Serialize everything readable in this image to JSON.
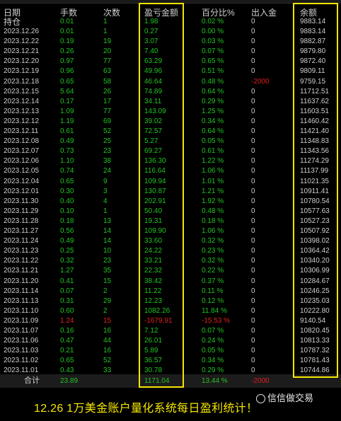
{
  "table": {
    "columns": {
      "date": "日期",
      "qty": "手数",
      "count": "次数",
      "pl": "盈亏金额",
      "pct": "百分比%",
      "flow": "出入金",
      "balance": "余额"
    },
    "holding": {
      "label": "持仓",
      "qty": "0.01",
      "count": "1",
      "pl": "1.98",
      "pct": "0.02 %",
      "flow": "0",
      "balance": "9883.14"
    },
    "rows": [
      {
        "date": "2023.12.26",
        "qty": "0.01",
        "count": "1",
        "pl": "0.27",
        "pct": "0.00 %",
        "flow": "0",
        "balance": "9883.14"
      },
      {
        "date": "2023.12.22",
        "qty": "0.19",
        "count": "19",
        "pl": "3.07",
        "pct": "0.03 %",
        "flow": "0",
        "balance": "9882.87"
      },
      {
        "date": "2023.12.21",
        "qty": "0.26",
        "count": "20",
        "pl": "7.40",
        "pct": "0.07 %",
        "flow": "0",
        "balance": "9879.80"
      },
      {
        "date": "2023.12.20",
        "qty": "0.97",
        "count": "77",
        "pl": "63.29",
        "pct": "0.65 %",
        "flow": "0",
        "balance": "9872.40"
      },
      {
        "date": "2023.12.19",
        "qty": "0.96",
        "count": "63",
        "pl": "49.96",
        "pct": "0.51 %",
        "flow": "0",
        "balance": "9809.11"
      },
      {
        "date": "2023.12.18",
        "qty": "0.65",
        "count": "58",
        "pl": "46.64",
        "pct": "0.48 %",
        "flow": "-2000",
        "balance": "9759.15",
        "flow_neg": true
      },
      {
        "date": "2023.12.15",
        "qty": "5.64",
        "count": "26",
        "pl": "74.89",
        "pct": "0.64 %",
        "flow": "0",
        "balance": "11712.51"
      },
      {
        "date": "2023.12.14",
        "qty": "0.17",
        "count": "17",
        "pl": "34.11",
        "pct": "0.29 %",
        "flow": "0",
        "balance": "11637.62"
      },
      {
        "date": "2023.12.13",
        "qty": "1.09",
        "count": "77",
        "pl": "143.09",
        "pct": "1.25 %",
        "flow": "0",
        "balance": "11603.51"
      },
      {
        "date": "2023.12.12",
        "qty": "1.19",
        "count": "69",
        "pl": "39.02",
        "pct": "0.34 %",
        "flow": "0",
        "balance": "11460.42"
      },
      {
        "date": "2023.12.11",
        "qty": "0.61",
        "count": "52",
        "pl": "72.57",
        "pct": "0.64 %",
        "flow": "0",
        "balance": "11421.40"
      },
      {
        "date": "2023.12.08",
        "qty": "0.49",
        "count": "25",
        "pl": "5.27",
        "pct": "0.05 %",
        "flow": "0",
        "balance": "11348.83"
      },
      {
        "date": "2023.12.07",
        "qty": "0.73",
        "count": "23",
        "pl": "69.27",
        "pct": "0.61 %",
        "flow": "0",
        "balance": "11343.56"
      },
      {
        "date": "2023.12.06",
        "qty": "1.10",
        "count": "38",
        "pl": "136.30",
        "pct": "1.22 %",
        "flow": "0",
        "balance": "11274.29"
      },
      {
        "date": "2023.12.05",
        "qty": "0.74",
        "count": "24",
        "pl": "116.64",
        "pct": "1.06 %",
        "flow": "0",
        "balance": "11137.99"
      },
      {
        "date": "2023.12.04",
        "qty": "0.65",
        "count": "9",
        "pl": "109.94",
        "pct": "1.01 %",
        "flow": "0",
        "balance": "11021.35"
      },
      {
        "date": "2023.12.01",
        "qty": "0.30",
        "count": "3",
        "pl": "130.87",
        "pct": "1.21 %",
        "flow": "0",
        "balance": "10911.41"
      },
      {
        "date": "2023.11.30",
        "qty": "0.40",
        "count": "4",
        "pl": "202.91",
        "pct": "1.92 %",
        "flow": "0",
        "balance": "10780.54"
      },
      {
        "date": "2023.11.29",
        "qty": "0.10",
        "count": "1",
        "pl": "50.40",
        "pct": "0.48 %",
        "flow": "0",
        "balance": "10577.63"
      },
      {
        "date": "2023.11.28",
        "qty": "0.18",
        "count": "13",
        "pl": "19.31",
        "pct": "0.18 %",
        "flow": "0",
        "balance": "10527.23"
      },
      {
        "date": "2023.11.27",
        "qty": "0.56",
        "count": "14",
        "pl": "109.90",
        "pct": "1.06 %",
        "flow": "0",
        "balance": "10507.92"
      },
      {
        "date": "2023.11.24",
        "qty": "0.49",
        "count": "14",
        "pl": "33.60",
        "pct": "0.32 %",
        "flow": "0",
        "balance": "10398.02"
      },
      {
        "date": "2023.11.23",
        "qty": "0.25",
        "count": "10",
        "pl": "24.22",
        "pct": "0.23 %",
        "flow": "0",
        "balance": "10364.42"
      },
      {
        "date": "2023.11.22",
        "qty": "0.32",
        "count": "23",
        "pl": "33.21",
        "pct": "0.32 %",
        "flow": "0",
        "balance": "10340.20"
      },
      {
        "date": "2023.11.21",
        "qty": "1.27",
        "count": "35",
        "pl": "22.32",
        "pct": "0.22 %",
        "flow": "0",
        "balance": "10306.99"
      },
      {
        "date": "2023.11.20",
        "qty": "0.41",
        "count": "15",
        "pl": "38.42",
        "pct": "0.37 %",
        "flow": "0",
        "balance": "10284.67"
      },
      {
        "date": "2023.11.14",
        "qty": "0.07",
        "count": "2",
        "pl": "11.22",
        "pct": "0.11 %",
        "flow": "0",
        "balance": "10246.25"
      },
      {
        "date": "2023.11.13",
        "qty": "0.31",
        "count": "29",
        "pl": "12.23",
        "pct": "0.12 %",
        "flow": "0",
        "balance": "10235.03"
      },
      {
        "date": "2023.11.10",
        "qty": "0.60",
        "count": "2",
        "pl": "1082.26",
        "pct": "11.84 %",
        "flow": "0",
        "balance": "10222.80"
      },
      {
        "date": "2023.11.09",
        "qty": "1.24",
        "count": "15",
        "pl": "-1679.91",
        "pct": "-15.53 %",
        "flow": "0",
        "balance": "9140.54",
        "loss": true
      },
      {
        "date": "2023.11.07",
        "qty": "0.16",
        "count": "16",
        "pl": "7.12",
        "pct": "0.07 %",
        "flow": "0",
        "balance": "10820.45"
      },
      {
        "date": "2023.11.06",
        "qty": "0.47",
        "count": "44",
        "pl": "26.01",
        "pct": "0.24 %",
        "flow": "0",
        "balance": "10813.33"
      },
      {
        "date": "2023.11.03",
        "qty": "0.21",
        "count": "16",
        "pl": "5.89",
        "pct": "0.05 %",
        "flow": "0",
        "balance": "10787.32"
      },
      {
        "date": "2023.11.02",
        "qty": "0.65",
        "count": "52",
        "pl": "36.57",
        "pct": "0.34 %",
        "flow": "0",
        "balance": "10781.43"
      },
      {
        "date": "2023.11.01",
        "qty": "0.43",
        "count": "33",
        "pl": "30.78",
        "pct": "0.29 %",
        "flow": "0",
        "balance": "10744.86"
      }
    ],
    "total": {
      "label": "合计",
      "qty": "23.89",
      "pl": "1171.04",
      "pct": "13.44 %",
      "flow": "-2000"
    }
  },
  "caption": "12.26 1万美金账户量化系统每日盈利统计！",
  "watermark": "信信做交易",
  "colors": {
    "profit": "#22c322",
    "loss": "#e02020",
    "highlight": "#f4e600"
  }
}
